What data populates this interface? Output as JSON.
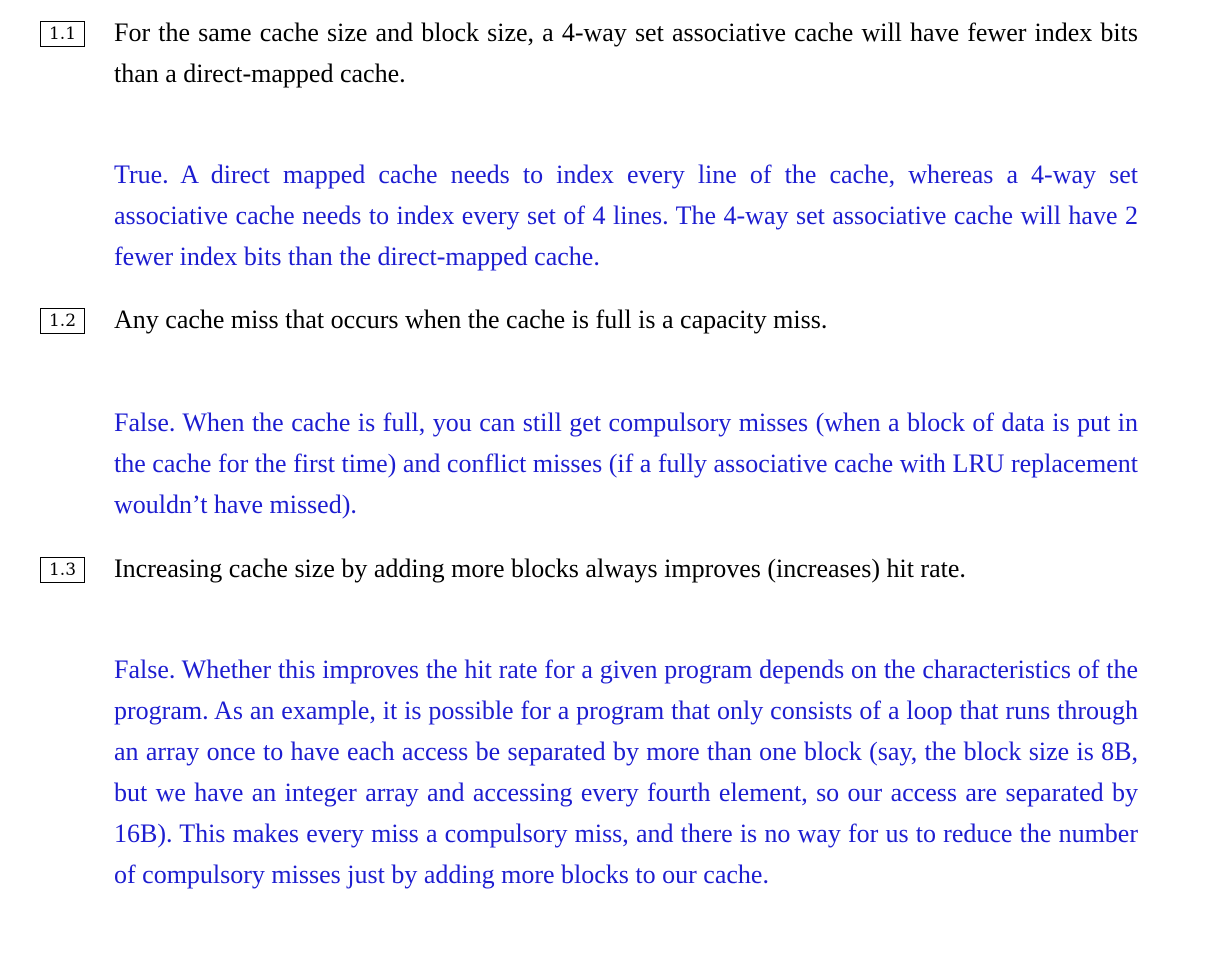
{
  "questions": [
    {
      "number": "1.1",
      "prompt": "For the same cache size and block size, a 4-way set associative cache will have fewer index bits than a direct-mapped cache.",
      "answer": "True. A direct mapped cache needs to index every line of the cache, whereas a 4-way set associative cache needs to index every set of 4 lines. The 4-way set associative cache will have 2 fewer index bits than the direct-mapped cache."
    },
    {
      "number": "1.2",
      "prompt": "Any cache miss that occurs when the cache is full is a capacity miss.",
      "answer": "False. When the cache is full, you can still get compulsory misses (when a block of data is put in the cache for the first time) and conflict misses (if a fully associative cache with LRU replacement wouldn’t have missed)."
    },
    {
      "number": "1.3",
      "prompt": "Increasing cache size by adding more blocks always improves (increases) hit rate.",
      "answer": "False. Whether this improves the hit rate for a given program depends on the characteristics of the program. As an example, it is possible for a program that only consists of a loop that runs through an array once to have each access be separated by more than one block (say, the block size is 8B, but we have an integer array and accessing every fourth element, so our access are separated by 16B). This makes every miss a compulsory miss, and there is no way for us to reduce the number of compulsory misses just by adding more blocks to our cache."
    }
  ],
  "colors": {
    "prompt_text": "#000000",
    "answer_text": "#1d1dd0"
  }
}
